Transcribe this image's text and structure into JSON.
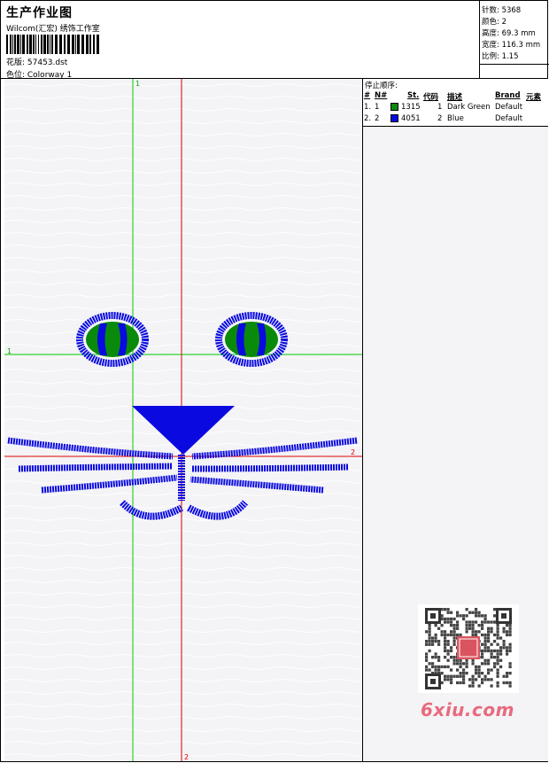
{
  "header": {
    "title": "生产作业图",
    "studio": "Wilcom(汇宏) 绣饰工作室",
    "design_label": "花版: 57453.dst",
    "colorway_label": "色位:  Colorway 1"
  },
  "stats": {
    "stitches": "针数: 5368",
    "colors": "颜色: 2",
    "height": "高度: 69.3 mm",
    "width": "宽度: 116.3 mm",
    "scale": "比例: 1.15"
  },
  "stop_sequence": {
    "title": "停止顺序:",
    "columns": [
      "#",
      "N#",
      "St.",
      "代码",
      "描述",
      "Brand",
      "元素"
    ],
    "rows": [
      {
        "idx": "1.",
        "n": "1",
        "color": "#0a8a0a",
        "st": "1315",
        "code": "1",
        "desc": "Dark Green",
        "brand": "Default"
      },
      {
        "idx": "2.",
        "n": "2",
        "color": "#0a0ae0",
        "st": "4051",
        "code": "2",
        "desc": "Blue",
        "brand": "Default"
      }
    ]
  },
  "design": {
    "guide_green_top": "1",
    "guide_green_left": "1",
    "guide_red_right": "2",
    "guide_red_bottom": "2",
    "colors": {
      "green": "#00cc00",
      "red": "#dd0000",
      "blue": "#0a0ae0",
      "dark_green": "#0a8a0a"
    }
  },
  "watermark": {
    "text": "6xiu.com"
  }
}
